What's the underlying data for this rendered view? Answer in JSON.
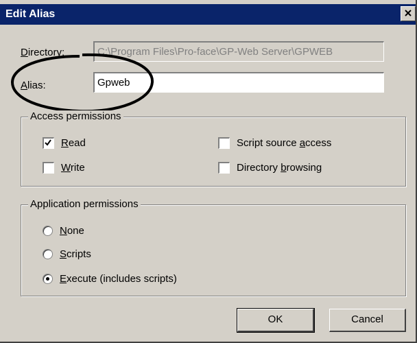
{
  "window": {
    "title": "Edit Alias",
    "close_glyph": "close-icon"
  },
  "directory": {
    "label_pre": "",
    "label_ul": "D",
    "label_post": "irectory:",
    "value": "C:\\Program Files\\Pro-face\\GP-Web Server\\GPWEB"
  },
  "alias": {
    "label_pre": "",
    "label_ul": "A",
    "label_post": "lias:",
    "value": "Gpweb"
  },
  "access": {
    "title": "Access permissions",
    "read": {
      "ul": "R",
      "rest": "ead",
      "checked": true
    },
    "write": {
      "ul": "W",
      "rest": "rite",
      "checked": false
    },
    "script": {
      "pre": "Script source ",
      "ul": "a",
      "post": "ccess",
      "checked": false
    },
    "browse": {
      "pre": "Directory ",
      "ul": "b",
      "post": "rowsing",
      "checked": false
    }
  },
  "app": {
    "title": "Application permissions",
    "none": {
      "ul": "N",
      "rest": "one",
      "selected": false
    },
    "scripts": {
      "ul": "S",
      "rest": "cripts",
      "selected": false
    },
    "execute": {
      "ul": "E",
      "rest": "xecute (includes scripts)",
      "selected": true
    }
  },
  "buttons": {
    "ok": "OK",
    "cancel": "Cancel"
  },
  "colors": {
    "titlebar": "#0a246a",
    "face": "#d4d0c8",
    "annotation": "#000000"
  }
}
